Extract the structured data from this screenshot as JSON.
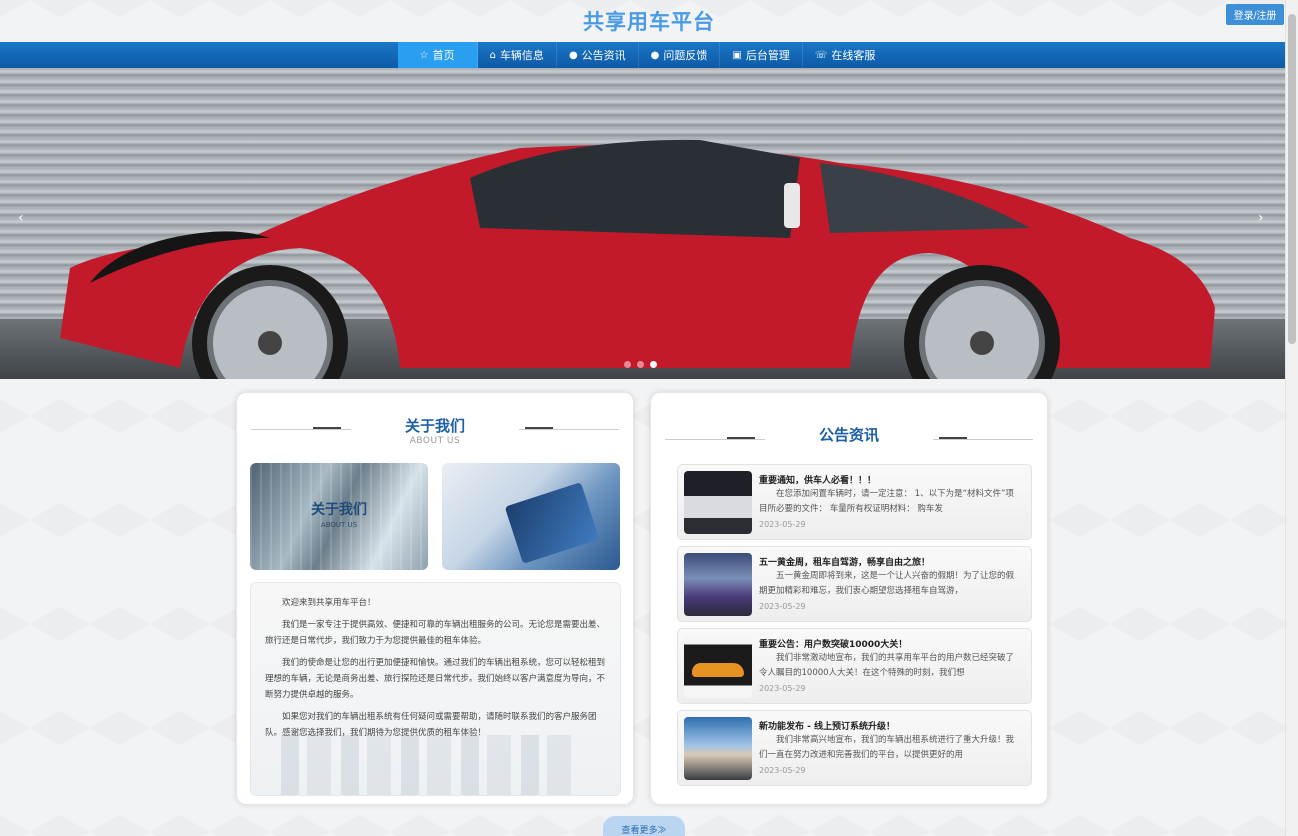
{
  "header": {
    "site_title": "共享用车平台",
    "login_label": "登录/注册"
  },
  "nav": [
    {
      "icon": "☆",
      "label": "首页"
    },
    {
      "icon": "⌂",
      "label": "车辆信息"
    },
    {
      "icon": "●",
      "label": "公告资讯"
    },
    {
      "icon": "●",
      "label": "问题反馈"
    },
    {
      "icon": "▣",
      "label": "后台管理"
    },
    {
      "icon": "☏",
      "label": "在线客服"
    }
  ],
  "banner": {
    "prev": "‹",
    "next": "›",
    "slide_count": 3,
    "active_slide": 3
  },
  "about": {
    "title": "关于我们",
    "subtitle": "ABOUT US",
    "image_title": "关于我们",
    "image_subtitle": "ABOUT US",
    "paragraphs": [
      "欢迎来到共享用车平台！",
      "我们是一家专注于提供高效、便捷和可靠的车辆出租服务的公司。无论您是需要出差、旅行还是日常代步，我们致力于为您提供最佳的租车体验。",
      "我们的使命是让您的出行更加便捷和愉快。通过我们的车辆出租系统，您可以轻松租到理想的车辆，无论是商务出差、旅行探险还是日常代步。我们始终以客户满意度为导向，不断努力提供卓越的服务。",
      "如果您对我们的车辆出租系统有任何疑问或需要帮助，请随时联系我们的客户服务团队。感谢您选择我们，我们期待为您提供优质的租车体验！"
    ]
  },
  "news": {
    "title": "公告资讯",
    "items": [
      {
        "title": "重要通知，供车人必看！！！",
        "body": "在您添加闲置车辆时，请一定注意： 1、以下为是“材料文件”项目所必要的文件： 车量所有权证明材料： 购车发",
        "date": "2023-05-29"
      },
      {
        "title": "五一黄金周，租车自驾游，畅享自由之旅！",
        "body": "五一黄金周即将到来，这是一个让人兴奋的假期！为了让您的假期更加精彩和难忘，我们衷心期望您选择租车自驾游，",
        "date": "2023-05-29"
      },
      {
        "title": "重要公告：用户数突破10000大关！",
        "body": "我们非常激动地宣布，我们的共享用车平台的用户数已经突破了令人瞩目的10000人大关！在这个特殊的时刻，我们想",
        "date": "2023-05-29"
      },
      {
        "title": "新功能发布 - 线上预订系统升级！",
        "body": "我们非常高兴地宣布，我们的车辆出租系统进行了重大升级！我们一直在努力改进和完善我们的平台，以提供更好的用",
        "date": "2023-05-29"
      }
    ]
  },
  "more_label": "查看更多≫"
}
